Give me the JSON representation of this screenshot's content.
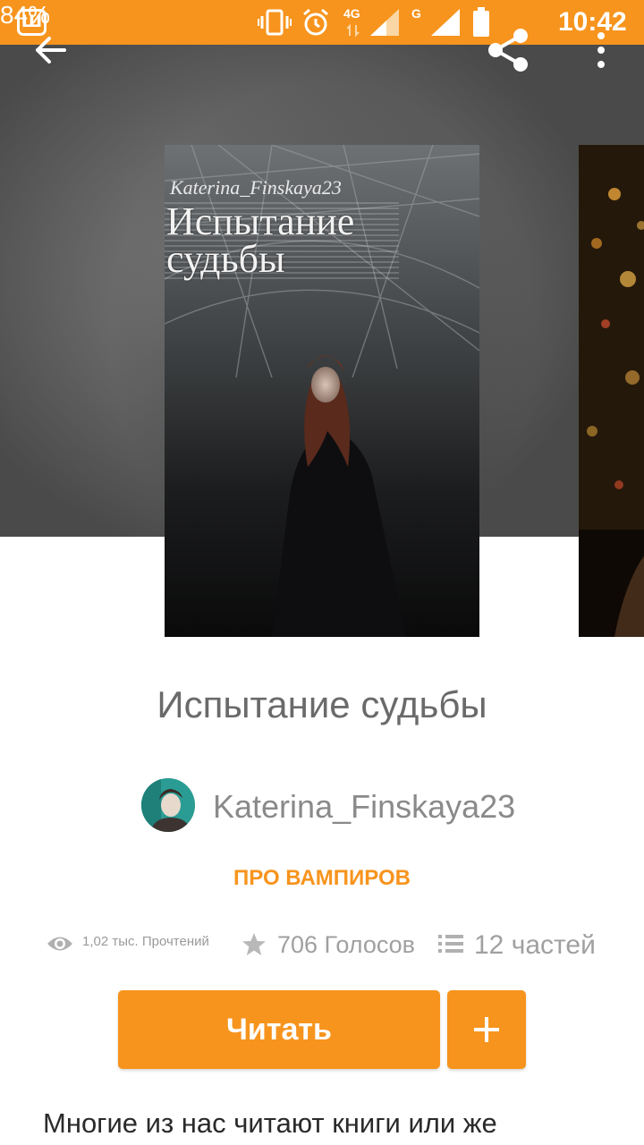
{
  "status_bar": {
    "app_icon_letter": "Ш",
    "network_4g": "4G",
    "network_g": "G",
    "battery": "84%",
    "time": "10:42"
  },
  "toolbar": {
    "back_icon": "arrow-left-icon",
    "share_icon": "share-icon",
    "more_icon": "more-vertical-icon"
  },
  "cover": {
    "author": "Katerina_Finskaya23",
    "title_line1": "Испытание",
    "title_line2": "судьбы"
  },
  "story": {
    "title": "Испытание судьбы",
    "author": "Katerina_Finskaya23",
    "category": "ПРО ВАМПИРОВ"
  },
  "stats": {
    "reads": "1,02 тыс. Прочтений",
    "votes": "706 Голосов",
    "parts": "12 частей"
  },
  "actions": {
    "read_label": "Читать",
    "add_label": "+"
  },
  "description": "Многие из нас читают книги или же",
  "colors": {
    "accent": "#f7941d",
    "title_text": "#6a6a6a",
    "muted_text": "#a0a0a0"
  }
}
